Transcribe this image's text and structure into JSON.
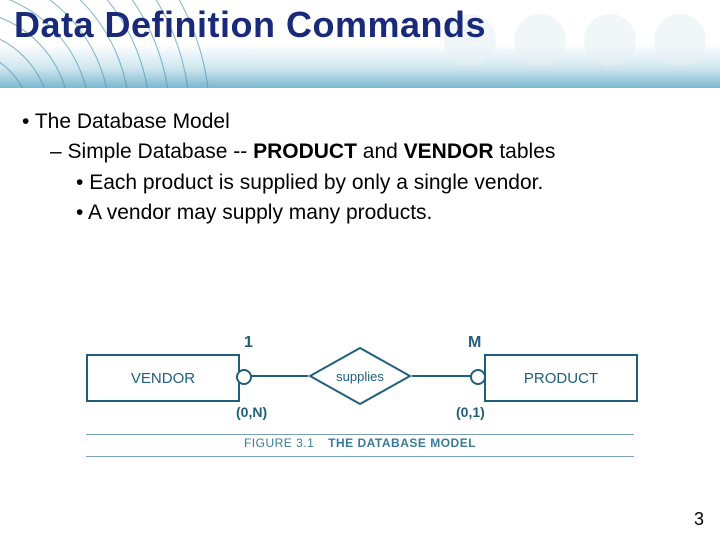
{
  "title": "Data Definition Commands",
  "bullets": {
    "b1": "The Database Model",
    "b2_pre": "Simple Database -- ",
    "b2_bold1": "PRODUCT",
    "b2_mid": " and ",
    "b2_bold2": "VENDOR",
    "b2_post": " tables",
    "b3a": "Each product is supplied by only a single vendor.",
    "b3b": "A vendor may supply many products."
  },
  "figure": {
    "left_entity": "VENDOR",
    "right_entity": "PRODUCT",
    "relationship": "supplies",
    "card_left_top": "1",
    "card_right_top": "M",
    "card_left_bottom": "(0,N)",
    "card_right_bottom": "(0,1)",
    "caption_num": "FIGURE 3.1",
    "caption_title": "THE DATABASE MODEL"
  },
  "page_number": "3"
}
